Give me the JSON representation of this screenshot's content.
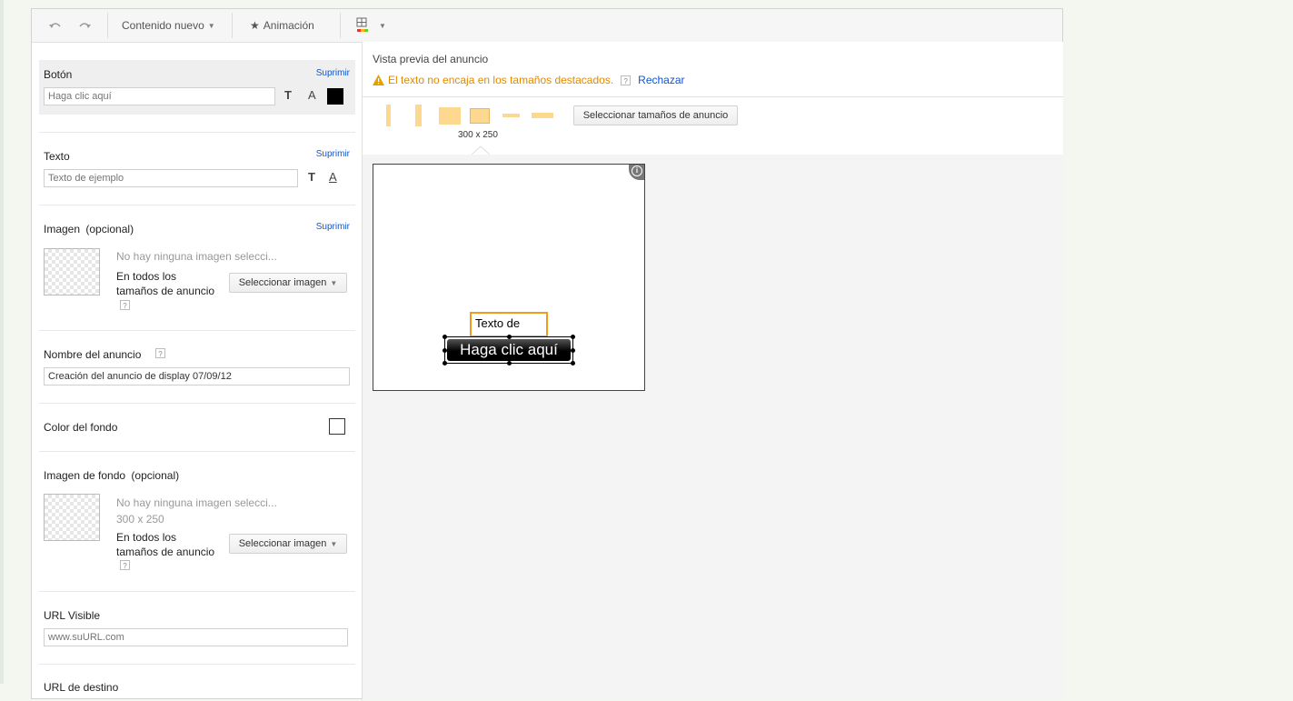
{
  "toolbar": {
    "undo_icon": "undo-icon",
    "redo_icon": "redo-icon",
    "new_content": "Contenido nuevo",
    "animation": "Animación",
    "layout_icon": "layout-icon"
  },
  "left": {
    "button_section": {
      "title": "Botón",
      "delete": "Suprimir",
      "placeholder": "Haga clic aquí",
      "color": "#000000"
    },
    "text_section": {
      "title": "Texto",
      "delete": "Suprimir",
      "placeholder": "Texto de ejemplo"
    },
    "image_section": {
      "title": "Imagen",
      "optional": "(opcional)",
      "delete": "Suprimir",
      "no_image": "No hay ninguna imagen selecci...",
      "all_sizes_1": "En todos los",
      "all_sizes_2": "tamaños de anuncio",
      "select_button": "Seleccionar imagen"
    },
    "ad_name_section": {
      "title": "Nombre del anuncio",
      "value": "Creación del anuncio de display 07/09/12"
    },
    "bg_color_section": {
      "title": "Color del fondo"
    },
    "bg_image_section": {
      "title": "Imagen de fondo",
      "optional": "(opcional)",
      "no_image": "No hay ninguna imagen selecci...",
      "size": "300 x 250",
      "all_sizes_1": "En todos los",
      "all_sizes_2": "tamaños de anuncio",
      "select_button": "Seleccionar imagen"
    },
    "visible_url_section": {
      "title": "URL Visible",
      "placeholder": "www.suURL.com"
    },
    "dest_url_section": {
      "title": "URL de destino"
    }
  },
  "preview": {
    "title": "Vista previa del anuncio",
    "warning": "El texto no encaja en los tamaños destacados.",
    "reject": "Rechazar",
    "select_sizes": "Seleccionar tamaños de anuncio",
    "current_size": "300 x 250",
    "ad_text": "Texto de",
    "ad_button": "Haga clic aquí"
  },
  "colors": {
    "link": "#1155cc",
    "warning": "#e08a00",
    "size_shape": "#fcd98f"
  }
}
